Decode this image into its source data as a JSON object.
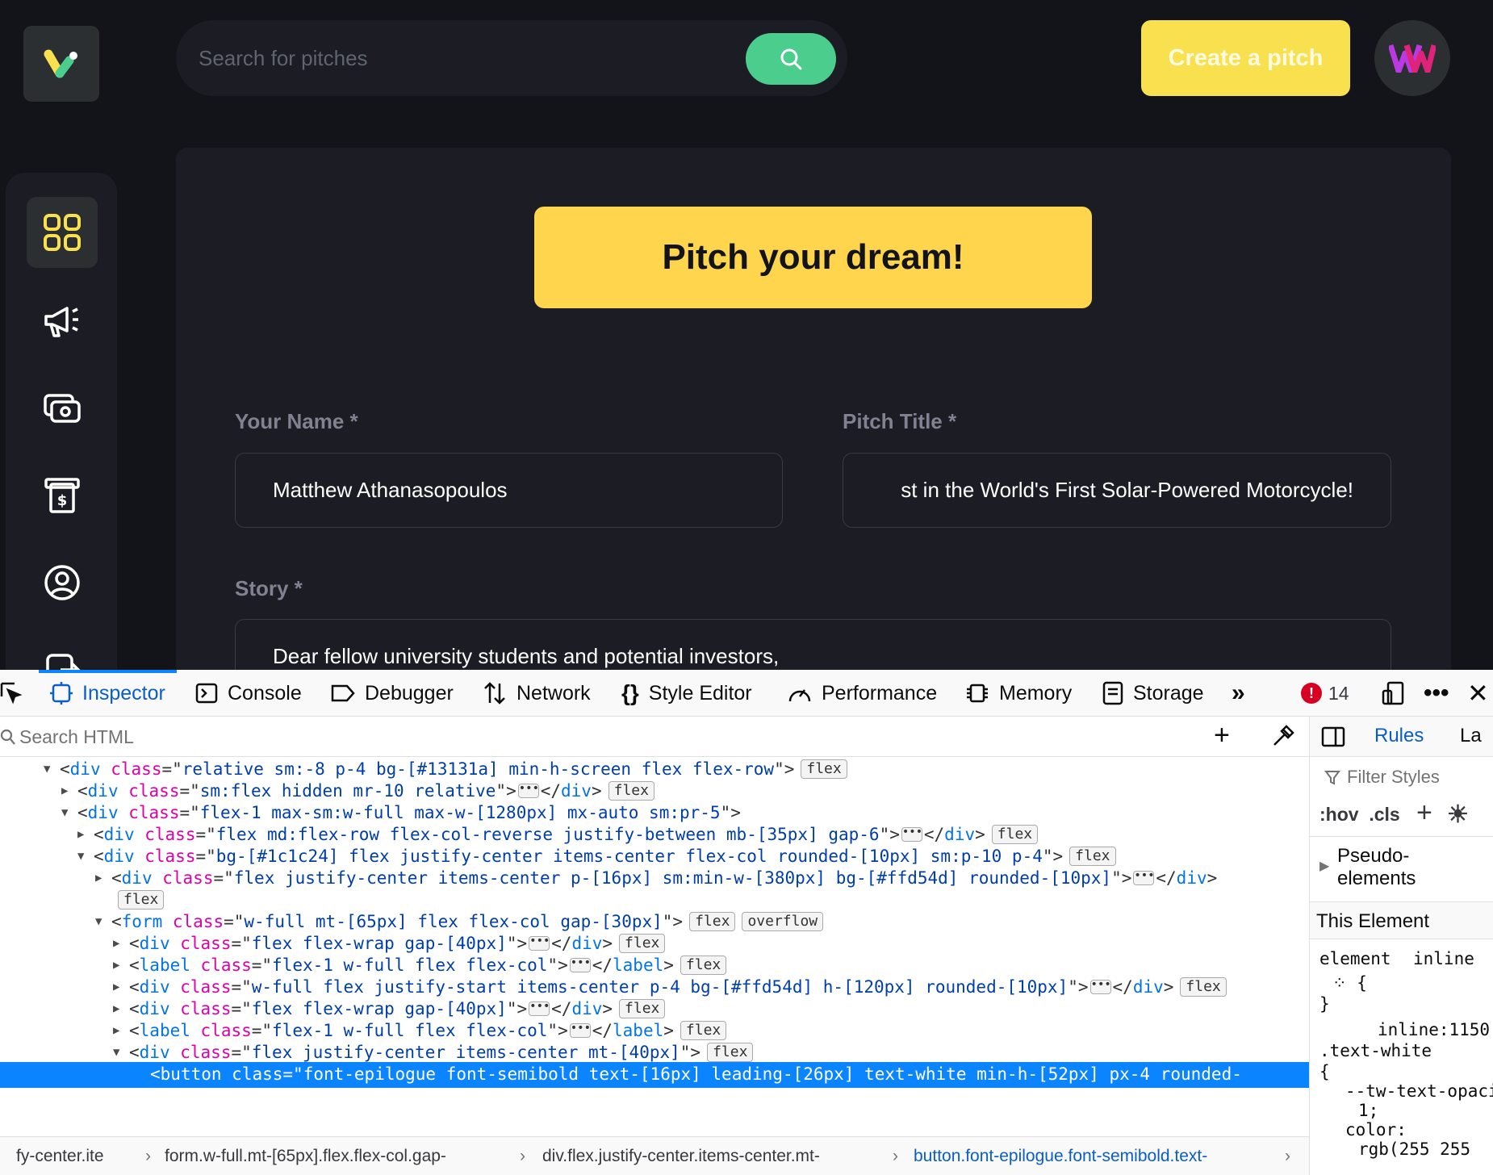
{
  "app": {
    "search": {
      "placeholder": "Search for pitches"
    },
    "create_button": "Create a pitch",
    "hero_title": "Pitch your dream!",
    "form": {
      "name_label": "Your Name *",
      "name_value": "Matthew Athanasopoulos",
      "title_label": "Pitch Title *",
      "title_value": "st in the World's First Solar-Powered Motorcycle!",
      "story_label": "Story *",
      "story_value": "Dear fellow university students and potential investors,"
    },
    "colors": {
      "background": "#13131a",
      "panel": "#1c1c24",
      "accent_yellow": "#ffd54d",
      "accent_green": "#4acd8d"
    },
    "sidebar_icons": [
      "dashboard-icon",
      "megaphone-icon",
      "camera-money-icon",
      "payment-receipt-icon",
      "profile-icon",
      "logout-icon"
    ]
  },
  "devtools": {
    "tabs": [
      {
        "label": "Inspector",
        "icon": "inspector-icon"
      },
      {
        "label": "Console",
        "icon": "console-icon"
      },
      {
        "label": "Debugger",
        "icon": "debugger-icon"
      },
      {
        "label": "Network",
        "icon": "network-icon"
      },
      {
        "label": "Style Editor",
        "icon": "style-editor-icon"
      },
      {
        "label": "Performance",
        "icon": "performance-icon"
      },
      {
        "label": "Memory",
        "icon": "memory-icon"
      },
      {
        "label": "Storage",
        "icon": "storage-icon"
      }
    ],
    "error_count": "14",
    "search_placeholder": "Search HTML",
    "tree": [
      {
        "tag": "div",
        "cls": "relative sm:-8 p-4 bg-[#13131a] min-h-screen flex flex-row",
        "badge": "flex"
      },
      {
        "tag": "div",
        "cls": "sm:flex hidden mr-10 relative",
        "badge": "flex"
      },
      {
        "tag": "div",
        "cls": "flex-1 max-sm:w-full max-w-[1280px] mx-auto sm:pr-5"
      },
      {
        "tag": "div",
        "cls": "flex md:flex-row flex-col-reverse justify-between mb-[35px] gap-6",
        "badge": "flex"
      },
      {
        "tag": "div",
        "cls": "bg-[#1c1c24] flex justify-center items-center flex-col rounded-[10px] sm:p-10 p-4",
        "badge": "flex"
      },
      {
        "tag": "div",
        "cls": "flex justify-center items-center p-[16px] sm:min-w-[380px] bg-[#ffd54d] rounded-[10px]"
      },
      {
        "badge": "flex"
      },
      {
        "tag": "form",
        "cls": "w-full mt-[65px] flex flex-col gap-[30px]",
        "badge": "flex",
        "badge2": "overflow"
      },
      {
        "tag": "div",
        "cls": "flex flex-wrap gap-[40px]",
        "badge": "flex"
      },
      {
        "tag": "label",
        "cls": "flex-1 w-full flex flex-col",
        "badge": "flex"
      },
      {
        "tag": "div",
        "cls": "w-full flex justify-start items-center p-4 bg-[#ffd54d] h-[120px] rounded-[10px]",
        "badge": "flex"
      },
      {
        "tag": "div",
        "cls": "flex flex-wrap gap-[40px]",
        "badge": "flex"
      },
      {
        "tag": "label",
        "cls": "flex-1 w-full flex flex-col",
        "badge": "flex"
      },
      {
        "tag": "div",
        "cls": "flex justify-center items-center mt-[40px]",
        "badge": "flex"
      },
      {
        "tag": "button",
        "cls": "font-epilogue font-semibold text-[16px] leading-[26px] text-white min-h-[52px] px-4 rounded-"
      }
    ],
    "breadcrumbs": [
      "fy-center.ite",
      "form.w-full.mt-[65px].flex.flex-col.gap-",
      "div.flex.justify-center.items-center.mt-",
      "button.font-epilogue.font-semibold.text-"
    ],
    "rules": {
      "tab_rules": "Rules",
      "tab_layout": "La",
      "filter_placeholder": "Filter Styles",
      "hov": ":hov",
      "cls": ".cls",
      "pseudo": "Pseudo-elements",
      "this_element": "This Element",
      "element_sel": "element",
      "element_src": "inline",
      "rule_src": "inline:1150",
      "rule_sel": ".text-white",
      "prop1": "--tw-text-opacity",
      "val1": "1;",
      "prop2": "color:",
      "val2": "rgb(255 255"
    }
  }
}
